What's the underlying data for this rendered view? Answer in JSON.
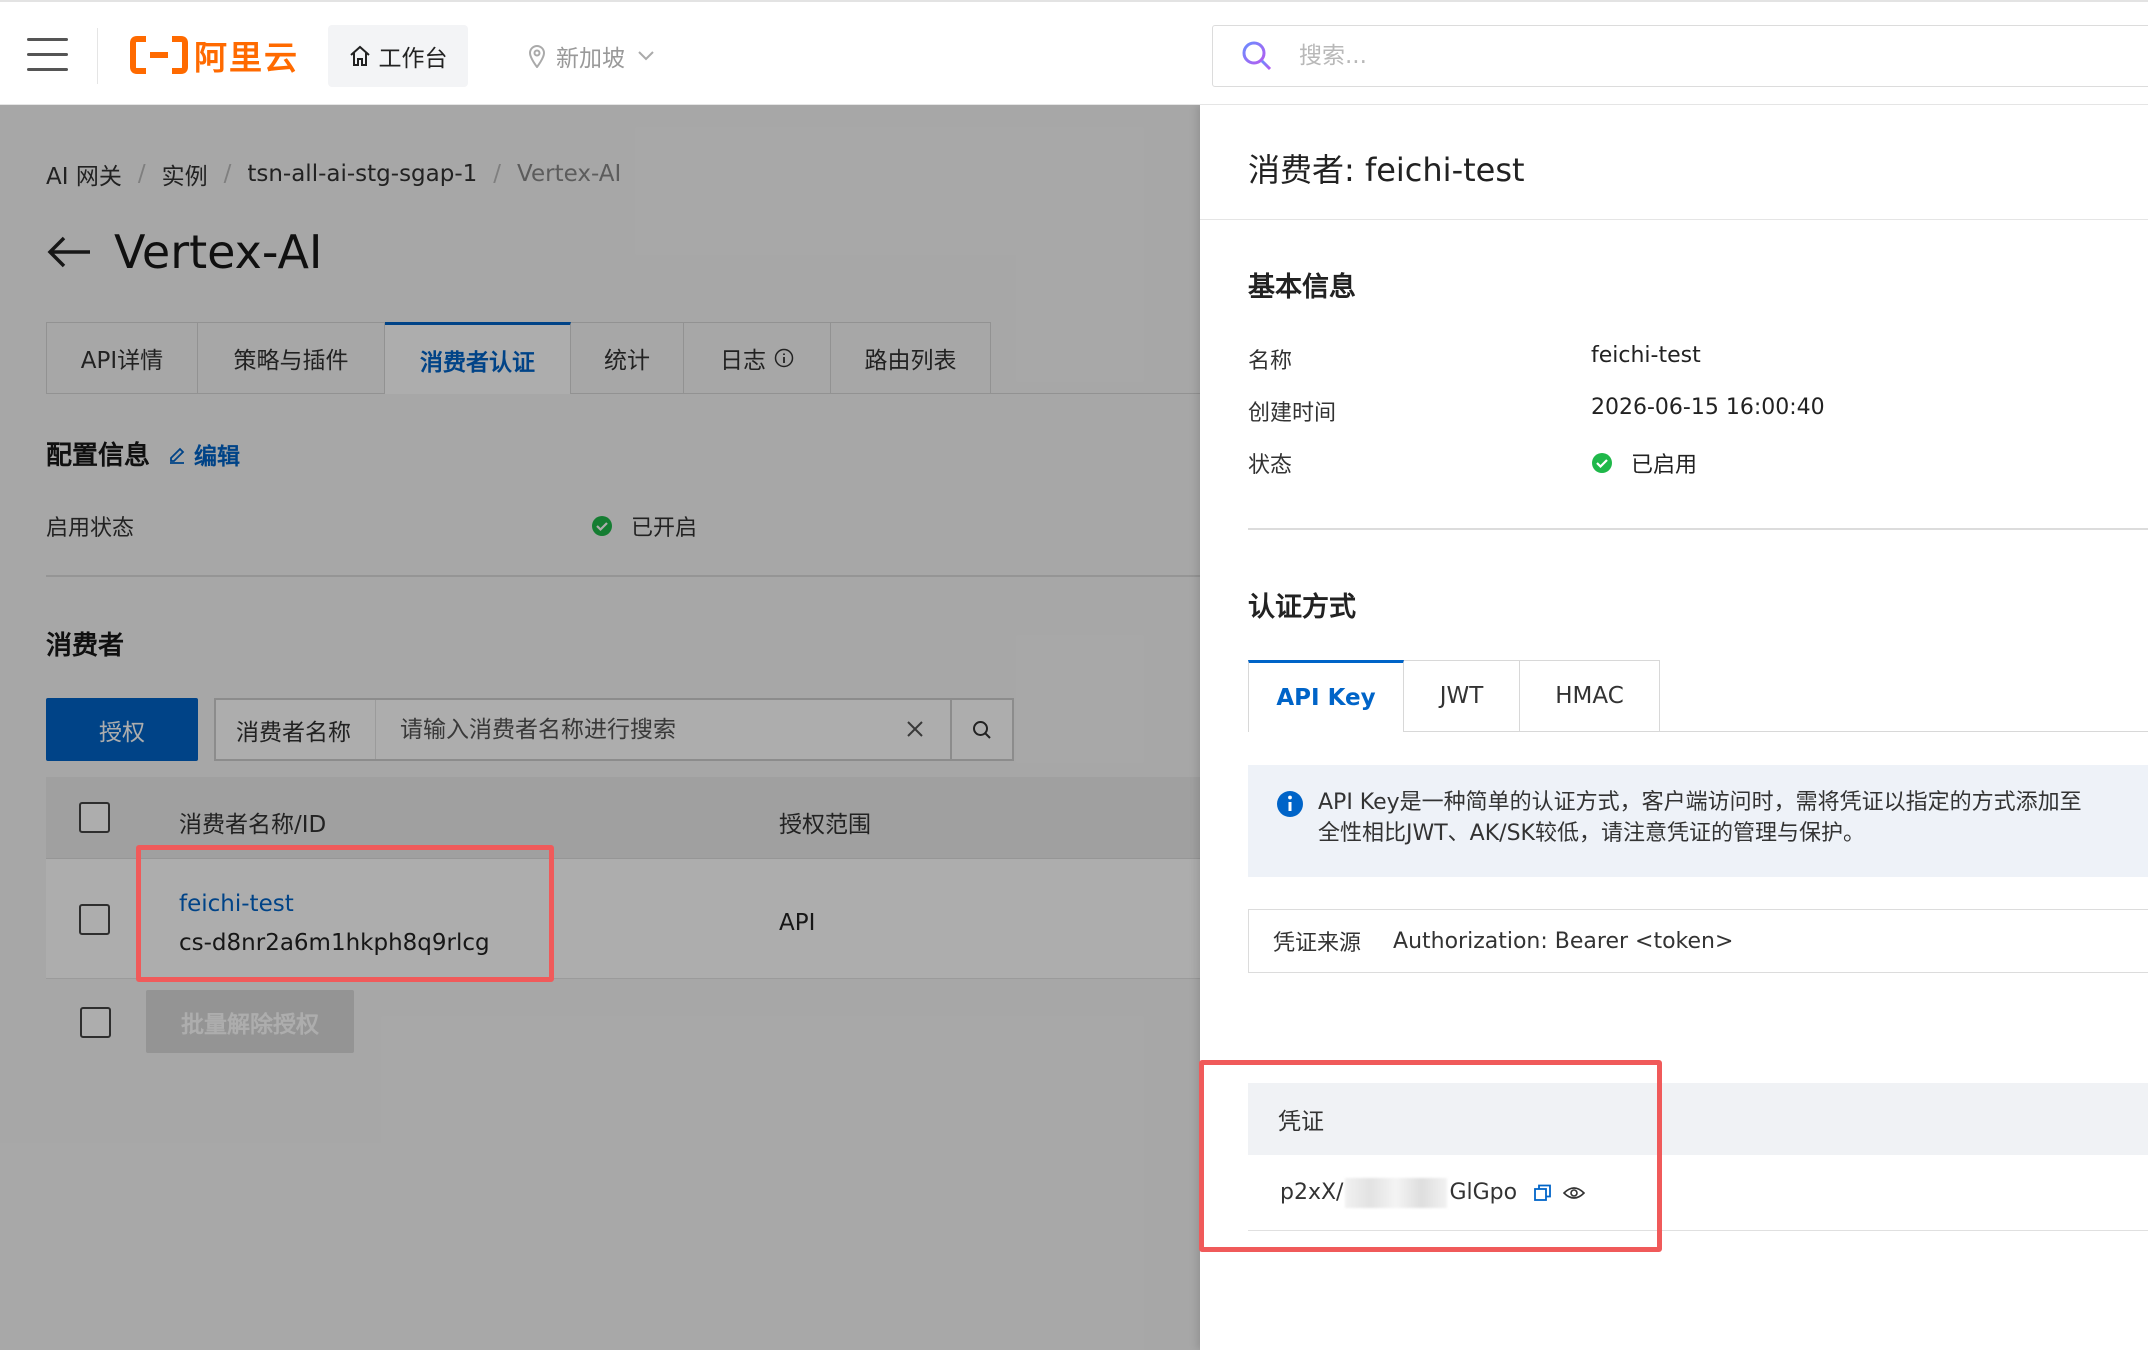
{
  "topbar": {
    "logo_text": "阿里云",
    "brand_color": "#ff6a00",
    "workbench_label": "工作台",
    "region_label": "新加坡",
    "search_placeholder": "搜索..."
  },
  "breadcrumb": [
    "AI 网关",
    "实例",
    "tsn-all-ai-stg-sgap-1",
    "Vertex-AI"
  ],
  "page": {
    "title": "Vertex-AI",
    "tabs": [
      {
        "label": "API详情",
        "active": false
      },
      {
        "label": "策略与插件",
        "active": false
      },
      {
        "label": "消费者认证",
        "active": true
      },
      {
        "label": "统计",
        "active": false
      },
      {
        "label": "日志",
        "active": false
      },
      {
        "label": "路由列表",
        "active": false
      }
    ],
    "config": {
      "heading": "配置信息",
      "edit_label": "编辑",
      "enable_label": "启用状态",
      "enable_value": "已开启"
    },
    "consumers": {
      "heading": "消费者",
      "authorize_button": "授权",
      "filter_label": "消费者名称",
      "filter_placeholder": "请输入消费者名称进行搜索",
      "columns": [
        "消费者名称/ID",
        "授权范围"
      ],
      "rows": [
        {
          "name": "feichi-test",
          "id": "cs-d8nr2a6m1hkph8q9rlcg",
          "scope": "API"
        }
      ],
      "batch_button": "批量解除授权"
    }
  },
  "drawer": {
    "title": "消费者: feichi-test",
    "basic_heading": "基本信息",
    "fields": [
      {
        "label": "名称",
        "value": "feichi-test"
      },
      {
        "label": "创建时间",
        "value": "2026-06-15 16:00:40"
      },
      {
        "label": "状态",
        "value": "已启用"
      }
    ],
    "auth_heading": "认证方式",
    "auth_tabs": [
      {
        "label": "API Key",
        "active": true
      },
      {
        "label": "JWT",
        "active": false
      },
      {
        "label": "HMAC",
        "active": false
      }
    ],
    "notice_line1": "API Key是一种简单的认证方式，客户端访问时，需将凭证以指定的方式添加至",
    "notice_line2": "全性相比JWT、AK/SK较低，请注意凭证的管理与保护。",
    "credential_source_label": "凭证来源",
    "credential_source_value": "Authorization: Bearer <token>",
    "credential_heading": "凭证",
    "credential_prefix": "p2xX/",
    "credential_suffix": "GlGpo"
  },
  "colors": {
    "accent": "#0064c8",
    "success": "#1fb84a",
    "highlight": "#f05a5a"
  }
}
